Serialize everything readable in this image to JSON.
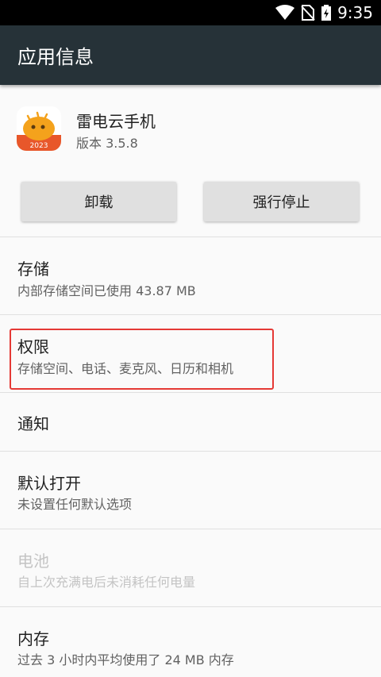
{
  "status_bar": {
    "time": "9:35",
    "icons": [
      "wifi-icon",
      "no-sim-icon",
      "battery-charging-icon"
    ]
  },
  "app_bar": {
    "title": "应用信息"
  },
  "app": {
    "name": "雷电云手机",
    "version": "版本 3.5.8",
    "icon_badge": "2023"
  },
  "buttons": {
    "uninstall": "卸载",
    "force_stop": "强行停止"
  },
  "items": [
    {
      "title": "存储",
      "subtitle": "内部存储空间已使用 43.87 MB",
      "enabled": true
    },
    {
      "title": "权限",
      "subtitle": "存储空间、电话、麦克风、日历和相机",
      "enabled": true,
      "highlighted": true
    },
    {
      "title": "通知",
      "subtitle": "",
      "enabled": true
    },
    {
      "title": "默认打开",
      "subtitle": "未设置任何默认选项",
      "enabled": true
    },
    {
      "title": "电池",
      "subtitle": "自上次充满电后未消耗任何电量",
      "enabled": false
    },
    {
      "title": "内存",
      "subtitle": "过去 3 小时内平均使用了 24 MB 内存",
      "enabled": true
    }
  ],
  "colors": {
    "app_bar": "#263238",
    "highlight": "#e53935",
    "button": "#e0e0e0",
    "icon_bg": "#f4a21c"
  }
}
